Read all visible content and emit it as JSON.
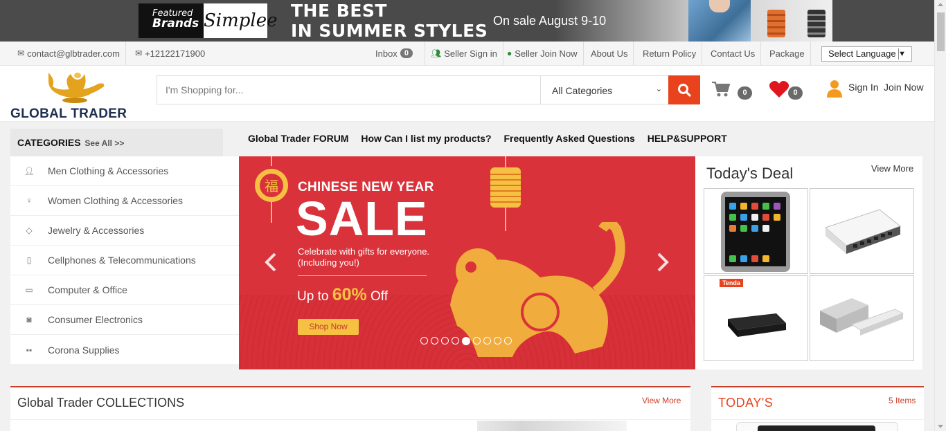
{
  "promo": {
    "featured_line1": "Featured",
    "featured_line2": "Brands",
    "brand": "Simplee",
    "headline1": "THE BEST",
    "headline2": "IN SUMMER STYLES",
    "sale_text": "On sale August 9-10"
  },
  "utility": {
    "email": "contact@glbtrader.com",
    "phone": "+12122171900",
    "inbox_label": "Inbox",
    "inbox_count": "0",
    "seller_signin": "Seller Sign in",
    "seller_join": "Seller Join Now",
    "about": "About Us",
    "return_policy": "Return Policy",
    "contact": "Contact Us",
    "package": "Package",
    "language": "Select Language"
  },
  "header": {
    "logo_text": "GLOBAL TRADER",
    "search_placeholder": "I'm Shopping for...",
    "category_selected": "All Categories",
    "cart_count": "0",
    "wishlist_count": "0",
    "sign_in": "Sign In",
    "join_now": "Join Now"
  },
  "categories": {
    "title": "CATEGORIES",
    "see_all": "See All >>",
    "items": [
      {
        "label": "Men Clothing & Accessories",
        "icon": "male-icon"
      },
      {
        "label": "Women Clothing & Accessories",
        "icon": "female-icon"
      },
      {
        "label": "Jewelry & Accessories",
        "icon": "diamond-icon"
      },
      {
        "label": "Cellphones & Telecommunications",
        "icon": "mobile-icon"
      },
      {
        "label": "Computer & Office",
        "icon": "desktop-icon"
      },
      {
        "label": "Consumer Electronics",
        "icon": "camera-icon"
      },
      {
        "label": "Corona Supplies",
        "icon": "truck-icon"
      }
    ]
  },
  "nav": {
    "forum": "Global Trader FORUM",
    "list_products": "How Can I list my products?",
    "faq": "Frequently Asked Questions",
    "help": "HELP&SUPPORT"
  },
  "hero": {
    "kicker": "CHINESE NEW YEAR",
    "title": "SALE",
    "sub1": "Celebrate with gifts for everyone.",
    "sub2": "(Including you!)",
    "upto_prefix": "Up to",
    "upto_value": "60%",
    "upto_suffix": "Off",
    "cta": "Shop Now",
    "slide_count": 9,
    "active_slide": 5,
    "charm_text": "福"
  },
  "deal": {
    "title": "Today's Deal",
    "view_more": "View More",
    "tile3_brand": "Tenda"
  },
  "collections": {
    "title": "Global Trader COLLECTIONS",
    "view_more": "View More"
  },
  "today": {
    "title": "TODAY'S",
    "items": "5 Items"
  },
  "colors": {
    "accent": "#e8431d",
    "hero_bg": "#d9323a",
    "gold": "#f6c143",
    "logo_navy": "#1d2e4f"
  }
}
